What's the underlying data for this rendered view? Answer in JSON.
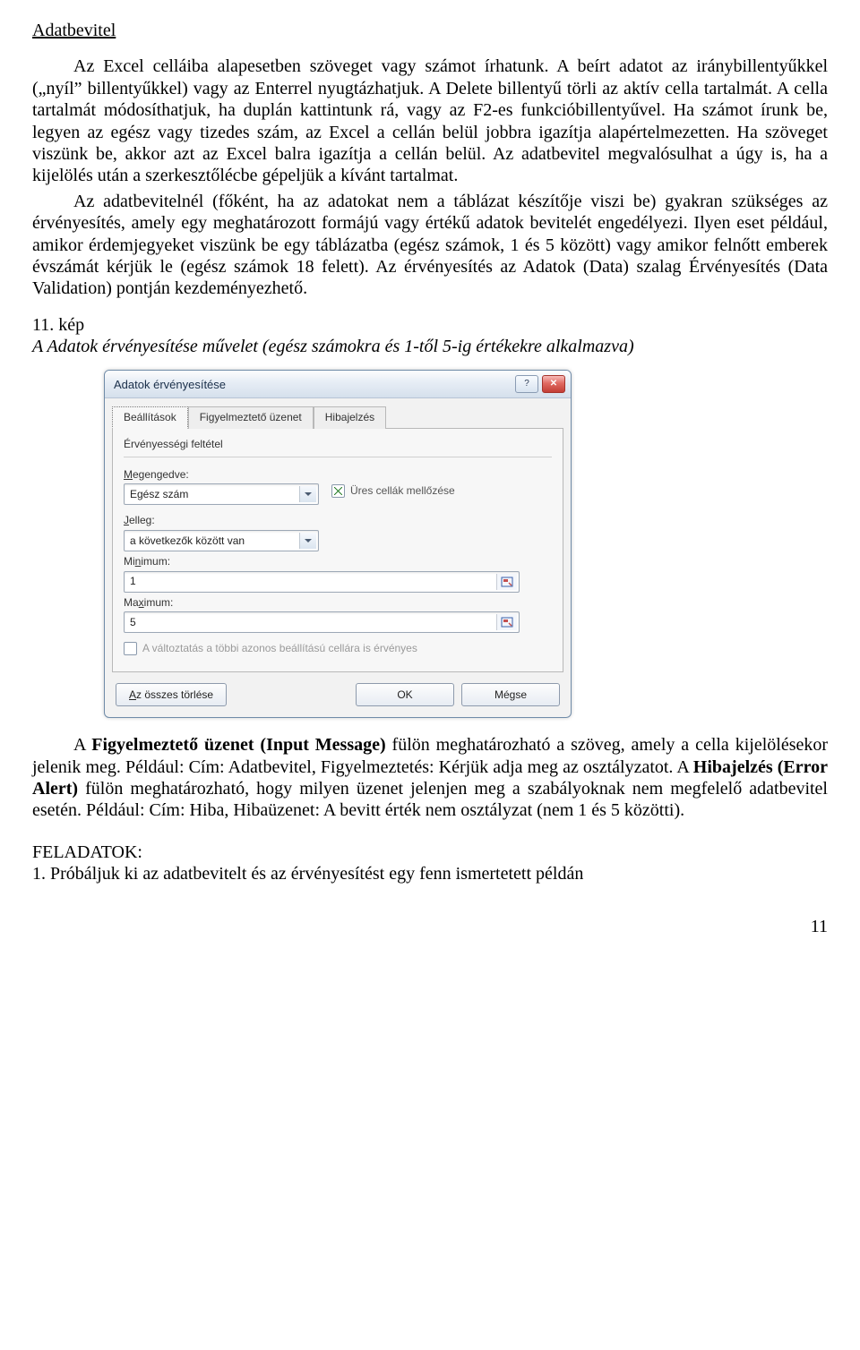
{
  "heading": "Adatbevitel",
  "para1": "Az Excel celláiba alapesetben szöveget vagy számot írhatunk. A beírt adatot az iránybillentyűkkel („nyíl” billentyűkkel) vagy az Enterrel nyugtázhatjuk. A Delete billentyű törli az aktív cella tartalmát. A cella tartalmát módosíthatjuk, ha duplán kattintunk rá, vagy az F2-es funkcióbillentyűvel. Ha számot írunk be, legyen az egész vagy tizedes szám, az Excel a cellán belül jobbra igazítja alapértelmezetten. Ha szöveget viszünk be, akkor azt az Excel balra igazítja a cellán belül. Az adatbevitel megvalósulhat a úgy is, ha a kijelölés után a szerkesztőlécbe gépeljük a kívánt tartalmat.",
  "para2_a": "Az adatbevitelnél (főként, ha az adatokat nem a táblázat készítője viszi be) gyakran szükséges az érvényesítés, amely egy meghatározott formájú vagy értékű adatok bevitelét engedélyezi. Ilyen eset például, amikor érdemjegyeket viszünk be egy táblázatba (egész számok, 1 és 5 között) vagy amikor felnőtt emberek évszámát kérjük le (egész számok 18 felett). ",
  "para2_b": "Az érvényesítés az Adatok (Data) szalag Érvényesítés (Data Validation) pontján kezdeményezhető.",
  "fignum": "11. kép",
  "figcap": "A Adatok érvényesítése művelet (egész számokra és 1-től 5-ig értékekre alkalmazva)",
  "dialog": {
    "title": "Adatok érvényesítése",
    "tabs": {
      "settings": "Beállítások",
      "input": "Figyelmeztető üzenet",
      "error": "Hibajelzés"
    },
    "group": "Érvényességi feltétel",
    "allow_lbl_pre": "M",
    "allow_lbl_post": "egengedve:",
    "allow_val": "Egész szám",
    "ignore_blank": "Üres cellák mellőzése",
    "data_lbl_pre": "J",
    "data_lbl_post": "elleg:",
    "data_val": "a következők között van",
    "min_lbl_pre": "Mi",
    "min_lbl_u": "n",
    "min_lbl_post": "imum:",
    "min_val": "1",
    "max_lbl_pre": "Ma",
    "max_lbl_u": "x",
    "max_lbl_post": "imum:",
    "max_val": "5",
    "apply_all": "A változtatás a többi azonos beállítású cellára is érvényes",
    "clear": "Az összes törlése",
    "ok": "OK",
    "cancel": "Mégse"
  },
  "para3_a": "A ",
  "para3_b": "Figyelmeztető üzenet (Input Message)",
  "para3_c": " fülön meghatározható a szöveg, amely a cella kijelölésekor jelenik meg. Például: Cím: Adatbevitel, Figyelmeztetés: Kérjük adja meg az osztályzatot. A ",
  "para3_d": "Hibajelzés (Error Alert)",
  "para3_e": " fülön meghatározható, hogy milyen üzenet jelenjen meg a szabályoknak nem megfelelő adatbevitel esetén. Például: Cím: Hiba, Hibaüzenet: A bevitt érték nem osztályzat (nem 1 és 5 közötti).",
  "tasks_title": "FELADATOK:",
  "task1": "1. Próbáljuk ki az adatbevitelt és az érvényesítést egy fenn ismertetett példán",
  "pagenum": "11"
}
